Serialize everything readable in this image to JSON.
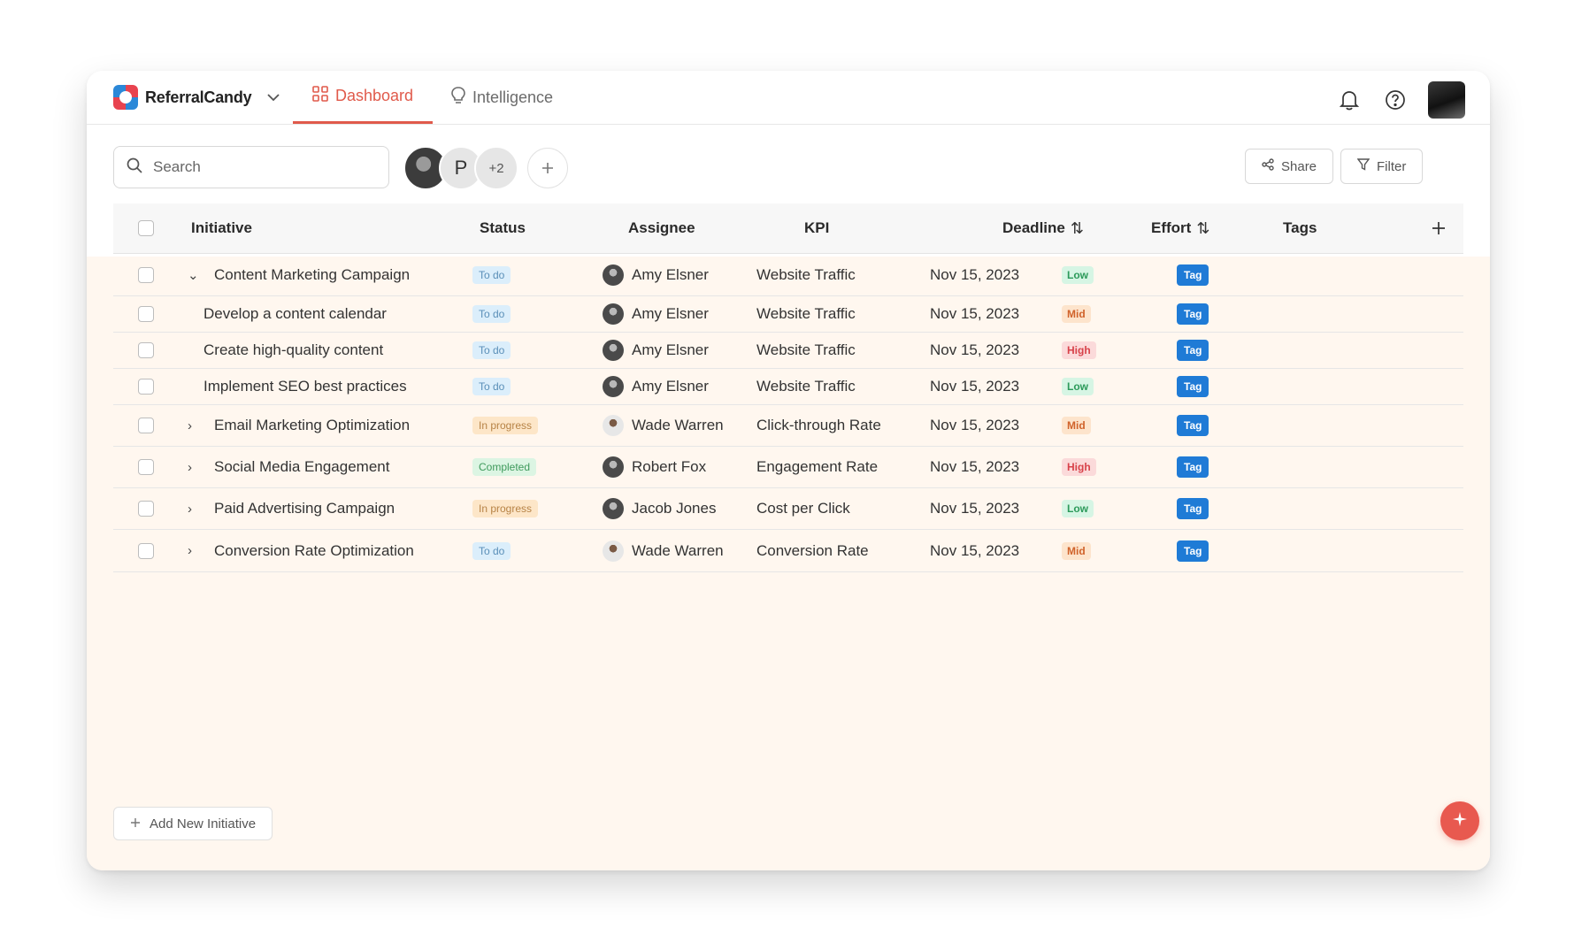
{
  "app": {
    "brand_name": "ReferralCandy",
    "tabs": [
      {
        "label": "Dashboard",
        "icon": "grid-icon",
        "active": true
      },
      {
        "label": "Intelligence",
        "icon": "lightbulb-icon",
        "active": false
      }
    ]
  },
  "toolbar": {
    "search_placeholder": "Search",
    "collaborators": {
      "letter": "P",
      "more": "+2"
    },
    "share_label": "Share",
    "filter_label": "Filter"
  },
  "table": {
    "headers": {
      "initiative": "Initiative",
      "status": "Status",
      "assignee": "Assignee",
      "kpi": "KPI",
      "deadline": "Deadline",
      "effort": "Effort",
      "tags": "Tags"
    },
    "rows": [
      {
        "initiative": "Content Marketing Campaign",
        "caret": "⌄",
        "status": "To do",
        "assignee": "Amy Elsner",
        "kpi": "Website Traffic",
        "deadline": "Nov 15, 2023",
        "effort": "Low",
        "tag": "Tag"
      },
      {
        "initiative": "Develop a content calendar",
        "caret": "",
        "status": "To do",
        "assignee": "Amy Elsner",
        "kpi": "Website Traffic",
        "deadline": "Nov 15, 2023",
        "effort": "Mid",
        "tag": "Tag"
      },
      {
        "initiative": "Create high-quality content",
        "caret": "",
        "status": "To do",
        "assignee": "Amy Elsner",
        "kpi": "Website Traffic",
        "deadline": "Nov 15, 2023",
        "effort": "High",
        "tag": "Tag"
      },
      {
        "initiative": "Implement SEO best practices",
        "caret": "",
        "status": "To do",
        "assignee": "Amy Elsner",
        "kpi": "Website Traffic",
        "deadline": "Nov 15, 2023",
        "effort": "Low",
        "tag": "Tag"
      },
      {
        "initiative": "Email Marketing Optimization",
        "caret": "›",
        "status": "In progress",
        "assignee": "Wade Warren",
        "kpi": "Click-through Rate",
        "deadline": "Nov 15, 2023",
        "effort": "Mid",
        "tag": "Tag"
      },
      {
        "initiative": "Social Media Engagement",
        "caret": "›",
        "status": "Completed",
        "assignee": "Robert Fox",
        "kpi": "Engagement Rate",
        "deadline": "Nov 15, 2023",
        "effort": "High",
        "tag": "Tag"
      },
      {
        "initiative": "Paid Advertising Campaign",
        "caret": "›",
        "status": "In progress",
        "assignee": "Jacob Jones",
        "kpi": "Cost per Click",
        "deadline": "Nov 15, 2023",
        "effort": "Low",
        "tag": "Tag"
      },
      {
        "initiative": "Conversion Rate Optimization",
        "caret": "›",
        "status": "To do",
        "assignee": "Wade Warren",
        "kpi": "Conversion Rate",
        "deadline": "Nov 15, 2023",
        "effort": "Mid",
        "tag": "Tag"
      }
    ]
  },
  "footer": {
    "add_initiative_label": "Add New Initiative"
  },
  "colors": {
    "accent": "#e05a4b",
    "tag_blue": "#1f7bd6",
    "row_tint": "#fff7ef"
  }
}
